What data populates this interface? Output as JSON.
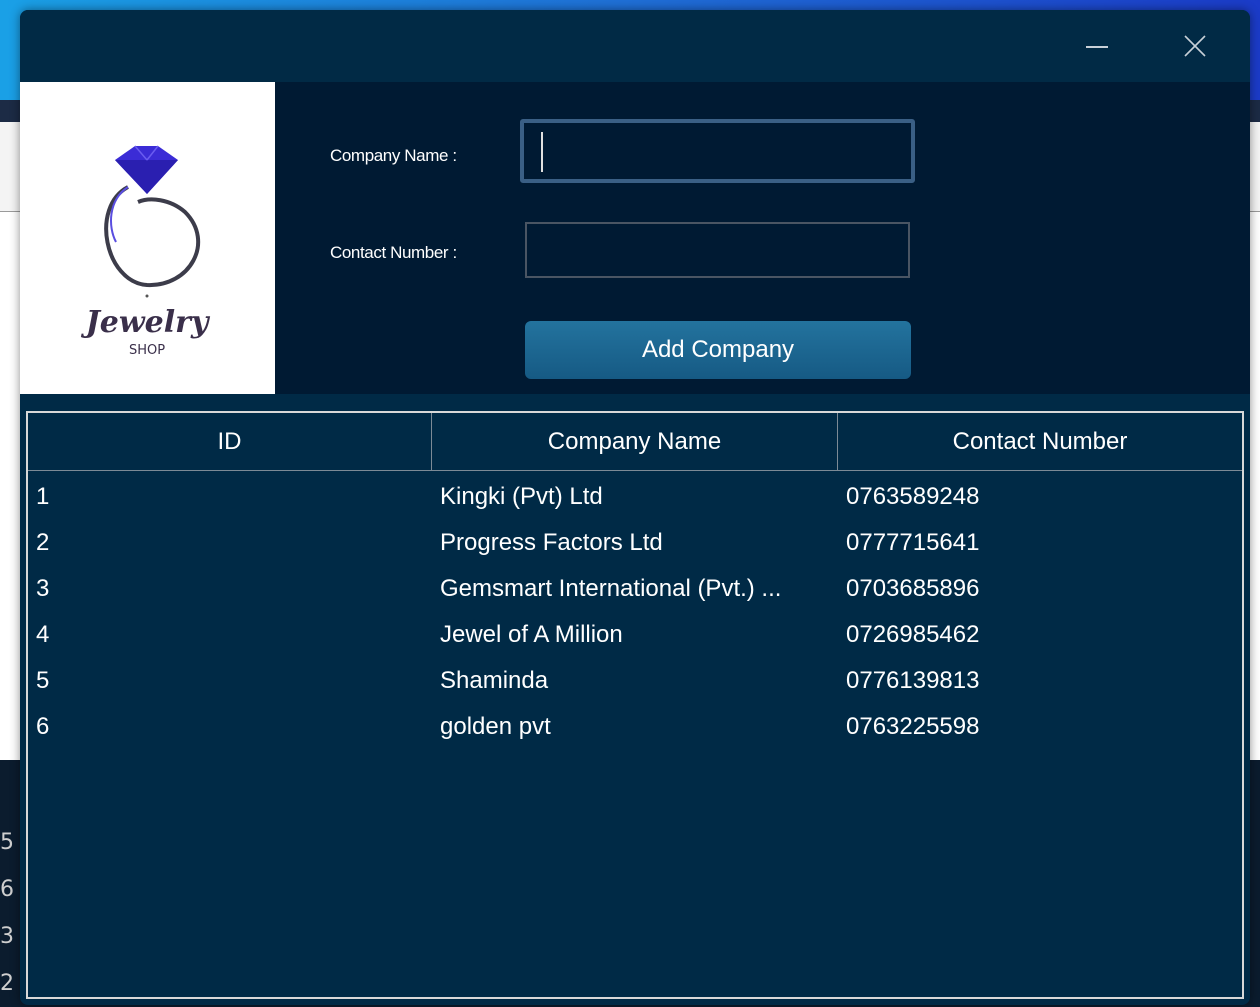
{
  "background": {
    "left_numbers": [
      "5",
      "6",
      "3",
      "2"
    ]
  },
  "window": {
    "minimize_icon": "minimize-icon",
    "close_icon": "close-icon"
  },
  "logo": {
    "script_text": "Jewelry",
    "sub_text": "SHOP"
  },
  "form": {
    "company_name_label": "Company Name :",
    "company_name_value": "",
    "contact_number_label": "Contact Number :",
    "contact_number_value": "",
    "add_button_label": "Add Company"
  },
  "table": {
    "headers": [
      "ID",
      "Company Name",
      "Contact Number"
    ],
    "rows": [
      {
        "id": "1",
        "name": "Kingki (Pvt) Ltd",
        "contact": "0763589248"
      },
      {
        "id": "2",
        "name": "Progress Factors Ltd",
        "contact": "0777715641"
      },
      {
        "id": "3",
        "name": "Gemsmart International (Pvt.) ...",
        "contact": "0703685896"
      },
      {
        "id": "4",
        "name": "Jewel of A Million",
        "contact": "0726985462"
      },
      {
        "id": "5",
        "name": "Shaminda",
        "contact": "0776139813"
      },
      {
        "id": "6",
        "name": "golden pvt",
        "contact": "0763225598"
      }
    ]
  },
  "colors": {
    "dialog_bg": "#002a46",
    "form_bg": "#001a33",
    "button_bg": "#1c6a94",
    "gem": "#3b2cd6"
  }
}
